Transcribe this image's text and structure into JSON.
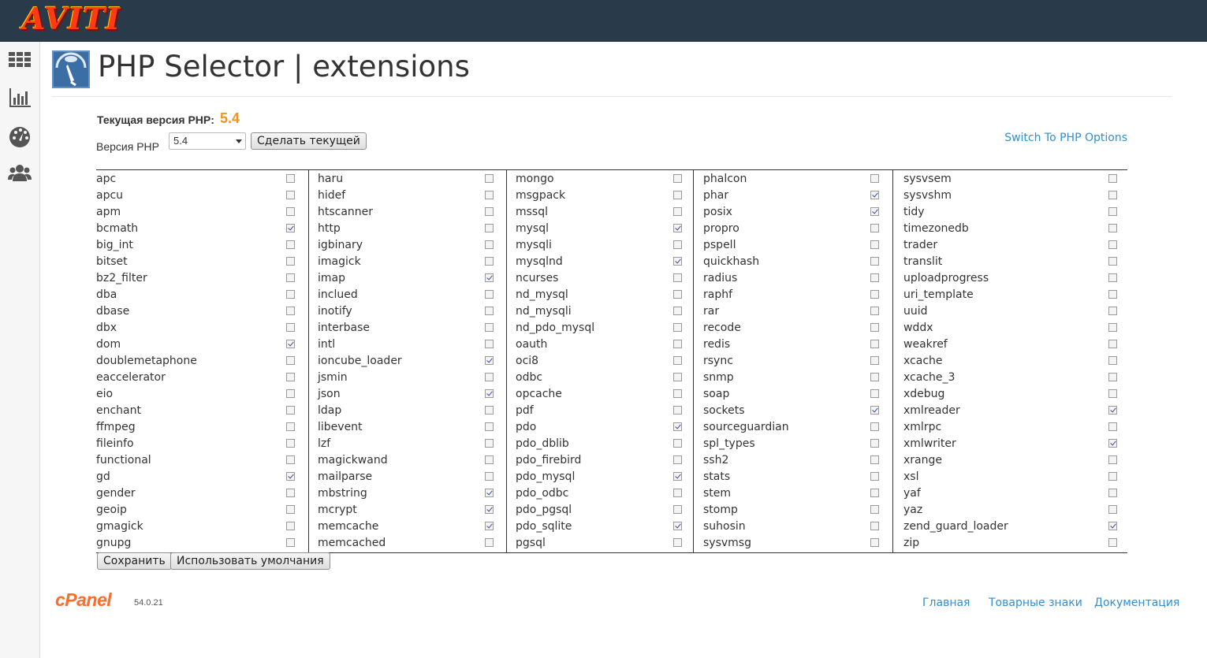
{
  "brand": {
    "logo_text": "AVITI"
  },
  "header": {
    "title": "PHP Selector | extensions"
  },
  "version": {
    "current_label": "Текущая версия PHP:",
    "current_value": "5.4",
    "select_label": "Версия PHP",
    "selected": "5.4",
    "make_current_label": "Сделать текущей"
  },
  "switch_link": "Switch To PHP Options",
  "columns": [
    [
      {
        "name": "apc",
        "checked": false
      },
      {
        "name": "apcu",
        "checked": false
      },
      {
        "name": "apm",
        "checked": false
      },
      {
        "name": "bcmath",
        "checked": true
      },
      {
        "name": "big_int",
        "checked": false
      },
      {
        "name": "bitset",
        "checked": false
      },
      {
        "name": "bz2_filter",
        "checked": false
      },
      {
        "name": "dba",
        "checked": false
      },
      {
        "name": "dbase",
        "checked": false
      },
      {
        "name": "dbx",
        "checked": false
      },
      {
        "name": "dom",
        "checked": true
      },
      {
        "name": "doublemetaphone",
        "checked": false
      },
      {
        "name": "eaccelerator",
        "checked": false
      },
      {
        "name": "eio",
        "checked": false
      },
      {
        "name": "enchant",
        "checked": false
      },
      {
        "name": "ffmpeg",
        "checked": false
      },
      {
        "name": "fileinfo",
        "checked": false
      },
      {
        "name": "functional",
        "checked": false
      },
      {
        "name": "gd",
        "checked": true
      },
      {
        "name": "gender",
        "checked": false
      },
      {
        "name": "geoip",
        "checked": false
      },
      {
        "name": "gmagick",
        "checked": false
      },
      {
        "name": "gnupg",
        "checked": false
      }
    ],
    [
      {
        "name": "haru",
        "checked": false
      },
      {
        "name": "hidef",
        "checked": false
      },
      {
        "name": "htscanner",
        "checked": false
      },
      {
        "name": "http",
        "checked": false
      },
      {
        "name": "igbinary",
        "checked": false
      },
      {
        "name": "imagick",
        "checked": false
      },
      {
        "name": "imap",
        "checked": true
      },
      {
        "name": "inclued",
        "checked": false
      },
      {
        "name": "inotify",
        "checked": false
      },
      {
        "name": "interbase",
        "checked": false
      },
      {
        "name": "intl",
        "checked": false
      },
      {
        "name": "ioncube_loader",
        "checked": true
      },
      {
        "name": "jsmin",
        "checked": false
      },
      {
        "name": "json",
        "checked": true
      },
      {
        "name": "ldap",
        "checked": false
      },
      {
        "name": "libevent",
        "checked": false
      },
      {
        "name": "lzf",
        "checked": false
      },
      {
        "name": "magickwand",
        "checked": false
      },
      {
        "name": "mailparse",
        "checked": false
      },
      {
        "name": "mbstring",
        "checked": true
      },
      {
        "name": "mcrypt",
        "checked": true
      },
      {
        "name": "memcache",
        "checked": true
      },
      {
        "name": "memcached",
        "checked": false
      }
    ],
    [
      {
        "name": "mongo",
        "checked": false
      },
      {
        "name": "msgpack",
        "checked": false
      },
      {
        "name": "mssql",
        "checked": false
      },
      {
        "name": "mysql",
        "checked": true
      },
      {
        "name": "mysqli",
        "checked": false
      },
      {
        "name": "mysqlnd",
        "checked": true
      },
      {
        "name": "ncurses",
        "checked": false
      },
      {
        "name": "nd_mysql",
        "checked": false
      },
      {
        "name": "nd_mysqli",
        "checked": false
      },
      {
        "name": "nd_pdo_mysql",
        "checked": false
      },
      {
        "name": "oauth",
        "checked": false
      },
      {
        "name": "oci8",
        "checked": false
      },
      {
        "name": "odbc",
        "checked": false
      },
      {
        "name": "opcache",
        "checked": false
      },
      {
        "name": "pdf",
        "checked": false
      },
      {
        "name": "pdo",
        "checked": true
      },
      {
        "name": "pdo_dblib",
        "checked": false
      },
      {
        "name": "pdo_firebird",
        "checked": false
      },
      {
        "name": "pdo_mysql",
        "checked": true
      },
      {
        "name": "pdo_odbc",
        "checked": false
      },
      {
        "name": "pdo_pgsql",
        "checked": false
      },
      {
        "name": "pdo_sqlite",
        "checked": true
      },
      {
        "name": "pgsql",
        "checked": false
      }
    ],
    [
      {
        "name": "phalcon",
        "checked": false
      },
      {
        "name": "phar",
        "checked": true
      },
      {
        "name": "posix",
        "checked": true
      },
      {
        "name": "propro",
        "checked": false
      },
      {
        "name": "pspell",
        "checked": false
      },
      {
        "name": "quickhash",
        "checked": false
      },
      {
        "name": "radius",
        "checked": false
      },
      {
        "name": "raphf",
        "checked": false
      },
      {
        "name": "rar",
        "checked": false
      },
      {
        "name": "recode",
        "checked": false
      },
      {
        "name": "redis",
        "checked": false
      },
      {
        "name": "rsync",
        "checked": false
      },
      {
        "name": "snmp",
        "checked": false
      },
      {
        "name": "soap",
        "checked": false
      },
      {
        "name": "sockets",
        "checked": true
      },
      {
        "name": "sourceguardian",
        "checked": false
      },
      {
        "name": "spl_types",
        "checked": false
      },
      {
        "name": "ssh2",
        "checked": false
      },
      {
        "name": "stats",
        "checked": false
      },
      {
        "name": "stem",
        "checked": false
      },
      {
        "name": "stomp",
        "checked": false
      },
      {
        "name": "suhosin",
        "checked": false
      },
      {
        "name": "sysvmsg",
        "checked": false
      }
    ],
    [
      {
        "name": "sysvsem",
        "checked": false
      },
      {
        "name": "sysvshm",
        "checked": false
      },
      {
        "name": "tidy",
        "checked": false
      },
      {
        "name": "timezonedb",
        "checked": false
      },
      {
        "name": "trader",
        "checked": false
      },
      {
        "name": "translit",
        "checked": false
      },
      {
        "name": "uploadprogress",
        "checked": false
      },
      {
        "name": "uri_template",
        "checked": false
      },
      {
        "name": "uuid",
        "checked": false
      },
      {
        "name": "wddx",
        "checked": false
      },
      {
        "name": "weakref",
        "checked": false
      },
      {
        "name": "xcache",
        "checked": false
      },
      {
        "name": "xcache_3",
        "checked": false
      },
      {
        "name": "xdebug",
        "checked": false
      },
      {
        "name": "xmlreader",
        "checked": true
      },
      {
        "name": "xmlrpc",
        "checked": false
      },
      {
        "name": "xmlwriter",
        "checked": true
      },
      {
        "name": "xrange",
        "checked": false
      },
      {
        "name": "xsl",
        "checked": false
      },
      {
        "name": "yaf",
        "checked": false
      },
      {
        "name": "yaz",
        "checked": false
      },
      {
        "name": "zend_guard_loader",
        "checked": true
      },
      {
        "name": "zip",
        "checked": false
      }
    ]
  ],
  "actions": {
    "save_label": "Сохранить",
    "defaults_label": "Использовать умолчания"
  },
  "footer": {
    "brand": "cPanel",
    "version": "54.0.21",
    "links": [
      "Главная",
      "Товарные знаки",
      "Документация"
    ]
  },
  "colors": {
    "accent": "#f0931e",
    "link": "#2f8fd4",
    "topbar": "#293a4a"
  }
}
